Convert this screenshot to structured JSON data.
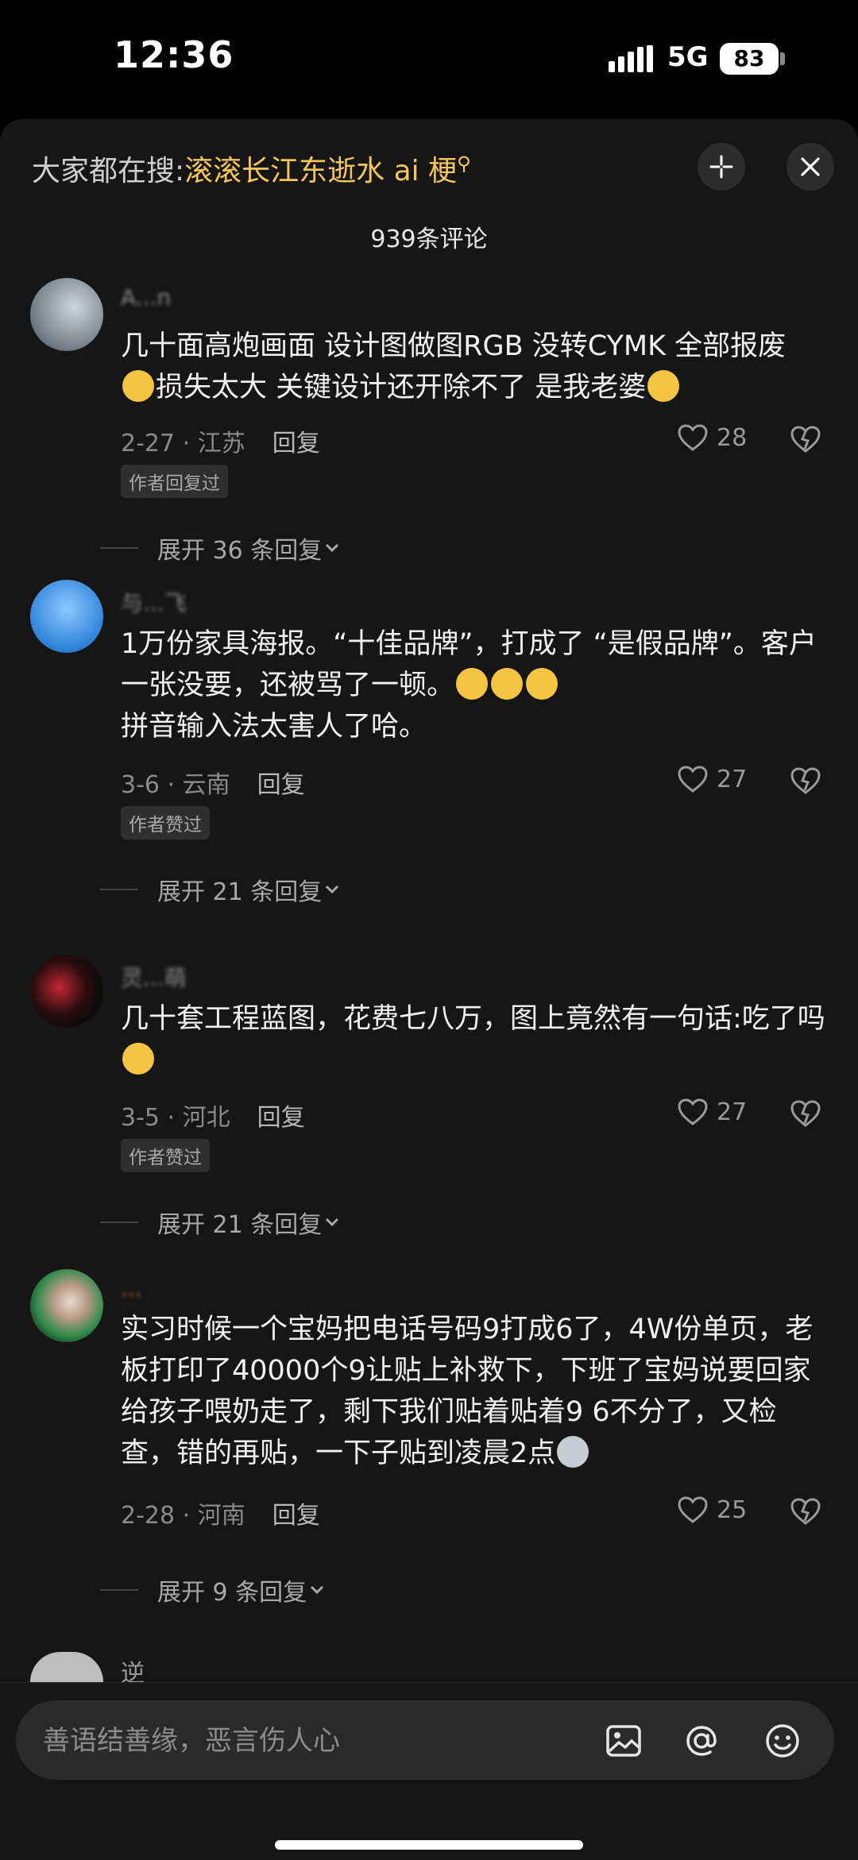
{
  "status": {
    "time": "12:36",
    "network": "5G",
    "battery": "83"
  },
  "search": {
    "prefix": "大家都在搜:",
    "term": "滚滚长江东逝水 ai 梗"
  },
  "comments_count": "939条评论",
  "comments": [
    {
      "username": "A...n",
      "text_a": "几十面高炮画面 设计图做图RGB 没转CYMK 全部报废",
      "text_b": "损失太大 关键设计还开除不了 是我老婆",
      "date": "2-27 · 江苏",
      "reply": "回复",
      "likes": "28",
      "badge": "作者回复过",
      "expand": "展开 36 条回复"
    },
    {
      "username": "与...飞",
      "text_a": "1万份家具海报。“十佳品牌”，打成了 “是假品牌”。客户一张没要，还被骂了一顿。",
      "text_b": "拼音输入法太害人了哈。",
      "date": "3-6 · 云南",
      "reply": "回复",
      "likes": "27",
      "badge": "作者赞过",
      "expand": "展开 21 条回复"
    },
    {
      "username": "灵...萌",
      "text_a": "几十套工程蓝图，花费七八万，图上竟然有一句话:吃了吗",
      "date": "3-5 · 河北",
      "reply": "回复",
      "likes": "27",
      "badge": "作者赞过",
      "expand": "展开 21 条回复"
    },
    {
      "username": "...",
      "text_a": "实习时候一个宝妈把电话号码9打成6了，4W份单页，老板打印了40000个9让贴上补救下，下班了宝妈说要回家给孩子喂奶走了，剩下我们贴着贴着9 6不分了，又检查，错的再贴，一下子贴到凌晨2点",
      "date": "2-28 · 河南",
      "reply": "回复",
      "likes": "25",
      "expand": "展开 9 条回复"
    },
    {
      "username": "逆"
    }
  ],
  "input": {
    "placeholder": "善语结善缘，恶言伤人心"
  },
  "icons": [
    "search-icon",
    "minimize-icon",
    "close-icon",
    "heart-icon",
    "dislike-icon",
    "chevron-down-icon",
    "image-icon",
    "at-icon",
    "emoji-icon"
  ],
  "colors": {
    "highlight": "#f6c65a",
    "sheet": "#161616",
    "muted": "#8a8a8a"
  }
}
